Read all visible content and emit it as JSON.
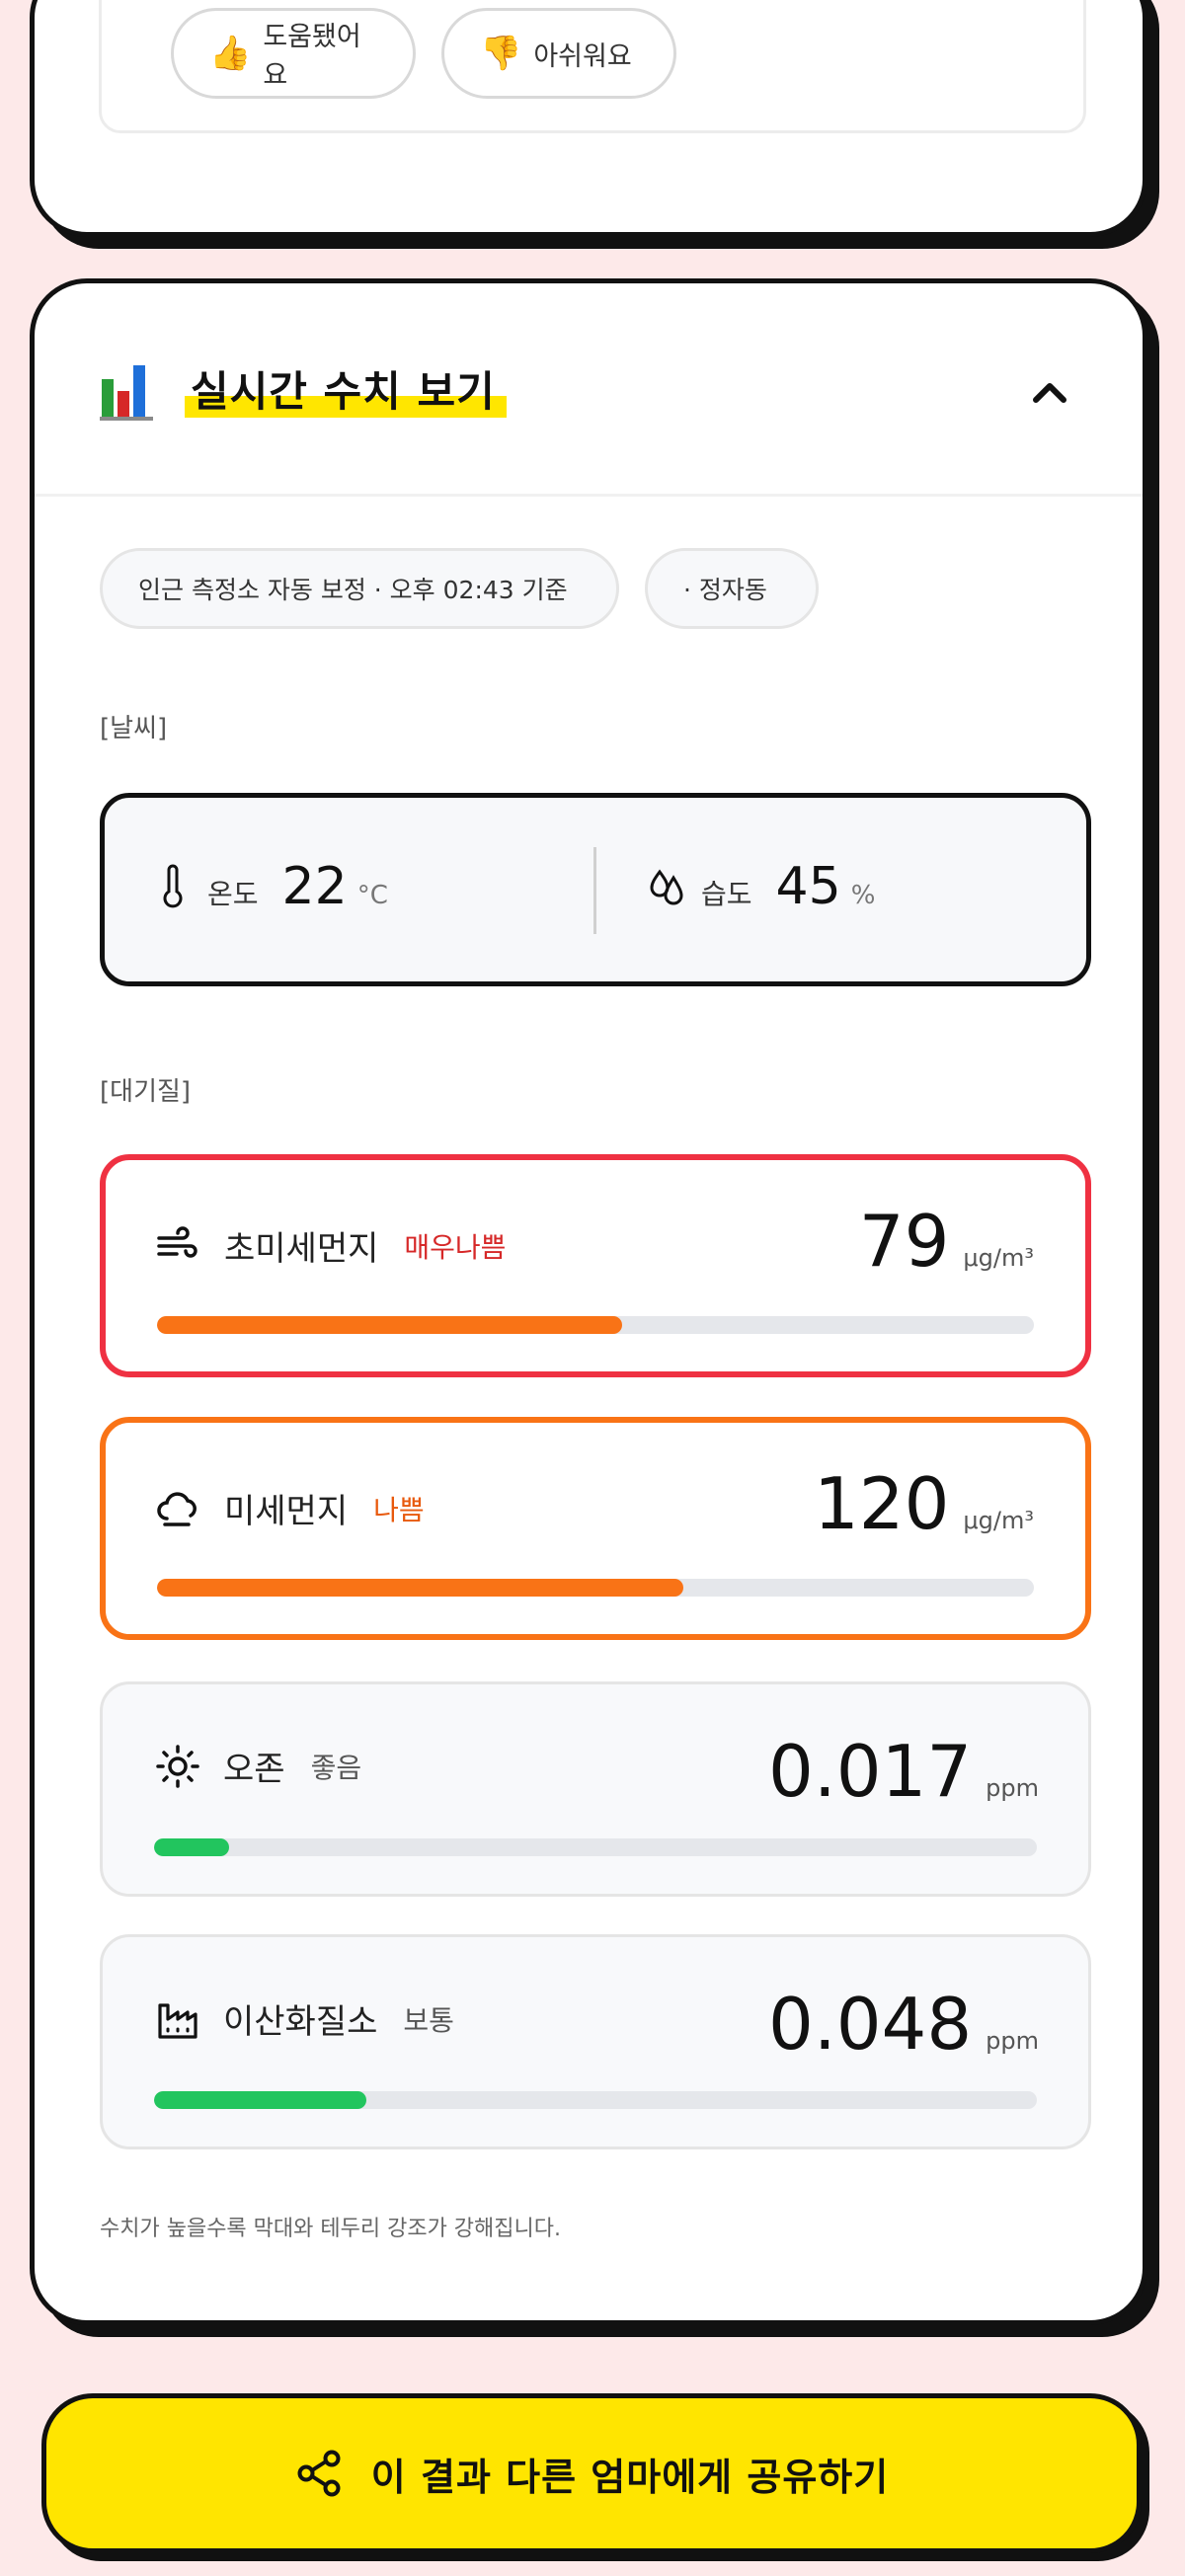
{
  "feedback": {
    "helpful_label": "도움됐어요",
    "helpful_emoji": "👍",
    "unhelpful_label": "아쉬워요",
    "unhelpful_emoji": "👎"
  },
  "realtime": {
    "title": "실시간 수치 보기",
    "source_chip": "인근 측정소 자동 보정 · 오후 02:43 기준",
    "region_chip": "· 정자동",
    "weather_label": "[날씨]",
    "air_label": "[대기질]",
    "weather": {
      "temp": {
        "label": "온도",
        "value": "22",
        "unit": "°C"
      },
      "humidity": {
        "label": "습도",
        "value": "45",
        "unit": "%"
      }
    },
    "metrics": [
      {
        "name": "초미세먼지",
        "status": "매우나쁨",
        "status_color": "#d62828",
        "value": "79",
        "unit": "μg/m³",
        "level": 0.53,
        "bar_color": "#f97316",
        "icon": "wind-icon"
      },
      {
        "name": "미세먼지",
        "status": "나쁨",
        "status_color": "#e8590c",
        "value": "120",
        "unit": "μg/m³",
        "level": 0.6,
        "bar_color": "#f97316",
        "icon": "cloud-icon"
      },
      {
        "name": "오존",
        "status": "좋음",
        "status_color": "#555555",
        "value": "0.017",
        "unit": "ppm",
        "level": 0.085,
        "bar_color": "#22c55e",
        "icon": "sun-icon"
      },
      {
        "name": "이산화질소",
        "status": "보통",
        "status_color": "#555555",
        "value": "0.048",
        "unit": "ppm",
        "level": 0.24,
        "bar_color": "#22c55e",
        "icon": "factory-icon"
      }
    ],
    "footnote": "수치가 높을수록 막대와 테두리 강조가 강해집니다."
  },
  "share": {
    "label": "이 결과 다른 엄마에게 공유하기"
  }
}
